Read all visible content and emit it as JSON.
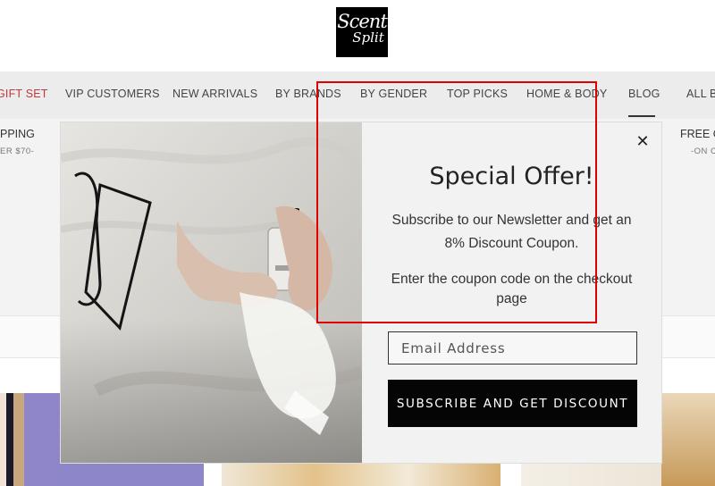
{
  "brand": {
    "logo_line1": "Scent",
    "logo_line2": "Split"
  },
  "nav": {
    "items": [
      "GIFT SET",
      "VIP CUSTOMERS",
      "NEW ARRIVALS",
      "BY BRANDS",
      "BY GENDER",
      "TOP PICKS",
      "HOME & BODY",
      "BLOG",
      "ALL BR"
    ],
    "active": "BLOG",
    "accent_color": "#c0393b"
  },
  "background": {
    "left_heading": "PPING",
    "left_sub": "ER $70-",
    "right_heading": "FREE C",
    "right_sub": "-ON C"
  },
  "modal": {
    "title": "Special Offer!",
    "description_line1": "Subscribe to our Newsletter and get an",
    "description_line2": "8% Discount Coupon.",
    "instruction": "Enter the coupon code on the checkout page",
    "email_placeholder": "Email Address",
    "submit_label": "SUBSCRIBE AND GET DISCOUNT",
    "close_glyph": "✕",
    "highlight_color": "#e00000"
  }
}
